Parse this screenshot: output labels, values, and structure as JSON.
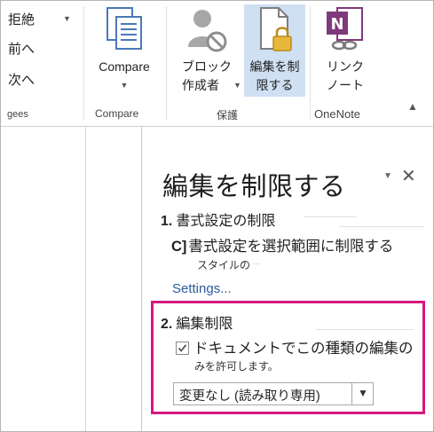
{
  "ribbon": {
    "small_buttons": [
      {
        "label": "拒絶",
        "has_dropdown": true
      },
      {
        "label": "前へ",
        "has_dropdown": false
      },
      {
        "label": "次へ",
        "has_dropdown": false
      }
    ],
    "groups": {
      "changes_label": "gees",
      "compare_label": "Compare",
      "protect_label": "保護",
      "onenote_label": "OneNote"
    },
    "compare_button": {
      "label": "Compare",
      "icon": "compare-icon"
    },
    "block_authors_button": {
      "line1": "ブロック",
      "line2": "作成者",
      "icon": "block-authors-icon"
    },
    "restrict_editing_button": {
      "line1": "編集を制",
      "line2": "限する",
      "icon": "restrict-editing-icon",
      "selected": true
    },
    "linked_notes_button": {
      "line1": "リンク",
      "line2": "ノート",
      "icon": "onenote-linked-notes-icon"
    },
    "accent_onenote": "#80397b"
  },
  "pane": {
    "title": "編集を制限する",
    "menu_glyph": "▼",
    "close_glyph": "✕",
    "section1": {
      "number": "1.",
      "title": "書式設定の制限",
      "checkbox_prefix": "C]",
      "checkbox_label": "書式設定を選択範囲に制限する",
      "sub_label": "スタイルの",
      "link": "Settings..."
    },
    "section2": {
      "number": "2.",
      "title": "編集制限",
      "checkbox_checked": true,
      "checkbox_label": "ドキュメントでこの種類の編集の",
      "sub_label": "みを許可します。",
      "dropdown_value": "変更なし (読み取り専用)"
    },
    "highlight_color": "#d6187f",
    "link_color": "#2b5b9e"
  }
}
